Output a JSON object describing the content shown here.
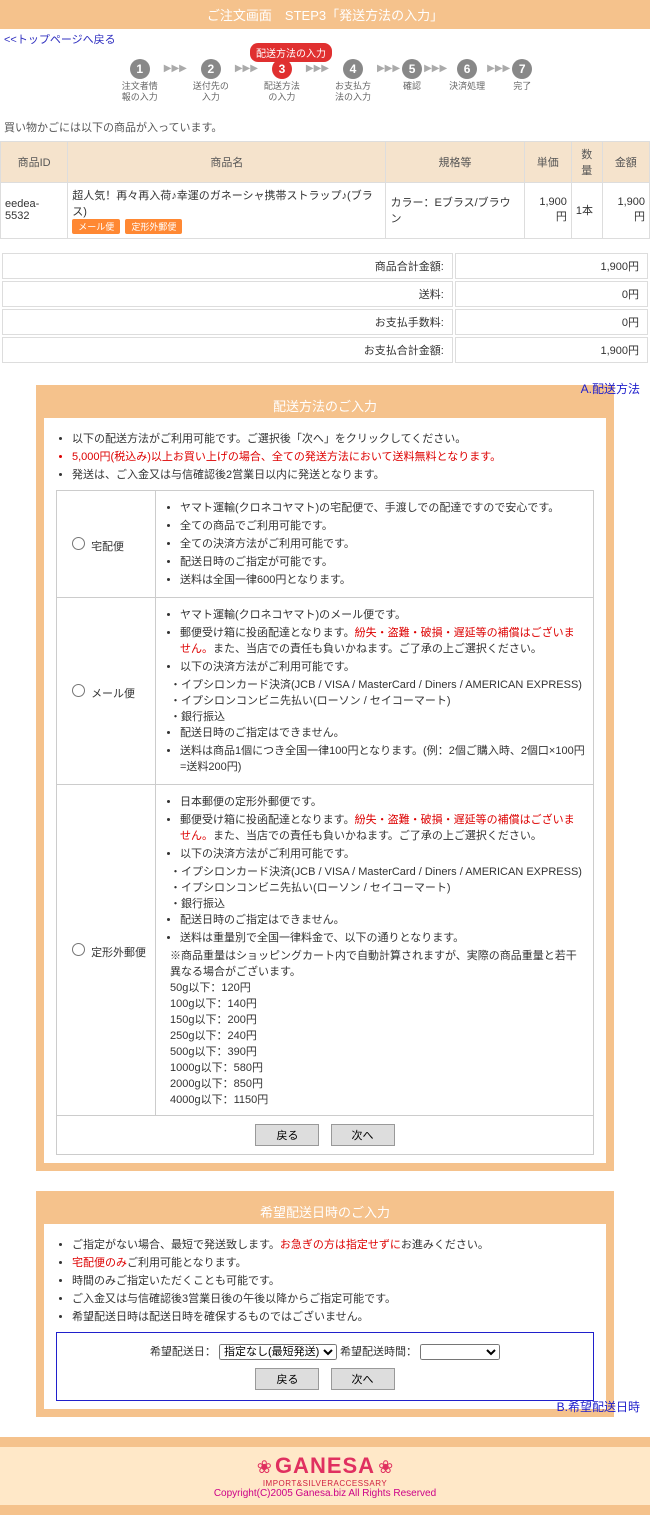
{
  "header": {
    "title": "ご注文画面　STEP3「発送方法の入力」"
  },
  "top_link": "<<トップページへ戻る",
  "balloon": "配送方法の入力",
  "steps": [
    {
      "num": "1",
      "label": "注文者情報の入力"
    },
    {
      "num": "2",
      "label": "送付先の入力"
    },
    {
      "num": "3",
      "label": "配送方法の入力"
    },
    {
      "num": "4",
      "label": "お支払方法の入力"
    },
    {
      "num": "5",
      "label": "確認"
    },
    {
      "num": "6",
      "label": "決済処理"
    },
    {
      "num": "7",
      "label": "完了"
    }
  ],
  "cart_note": "買い物かごには以下の商品が入っています。",
  "cart_headers": {
    "id": "商品ID",
    "name": "商品名",
    "spec": "規格等",
    "price": "単価",
    "qty": "数量",
    "amount": "金額"
  },
  "cart_row": {
    "id": "eedea-5532",
    "name": "超人気！再々再入荷♪幸運のガネーシャ携帯ストラップ♪(ブラス)",
    "badge1": "メール便",
    "badge2": "定形外郵便",
    "spec": "カラー：Eブラス/ブラウン",
    "price": "1,900円",
    "qty": "1本",
    "amount": "1,900円"
  },
  "totals": {
    "l1": "商品合計金額:",
    "v1": "1,900円",
    "l2": "送料:",
    "v2": "0円",
    "l3": "お支払手数料:",
    "v3": "0円",
    "l4": "お支払合計金額:",
    "v4": "1,900円"
  },
  "ship": {
    "head": "配送方法のご入力",
    "intro1": "以下の配送方法がご利用可能です。ご選択後「次へ」をクリックしてください。",
    "intro2": "5,000円(税込み)以上お買い上げの場合、全ての発送方法において送料無料となります。",
    "intro3": "発送は、ご入金又は与信確認後2営業日以内に発送となります。",
    "opt1": {
      "label": "宅配便",
      "l1": "ヤマト運輸(クロネコヤマト)の宅配便で、手渡しでの配達ですので安心です。",
      "l2": "全ての商品でご利用可能です。",
      "l3": "全ての決済方法がご利用可能です。",
      "l4": "配送日時のご指定が可能です。",
      "l5": "送料は全国一律600円となります。"
    },
    "opt2": {
      "label": "メール便",
      "l1": "ヤマト運輸(クロネコヤマト)のメール便です。",
      "l2a": "郵便受け箱に投函配達となります。",
      "l2b": "紛失・盗難・破損・遅延等の補償はございません。",
      "l2c": "また、当店での責任も負いかねます。ご了承の上ご選択ください。",
      "l3": "以下の決済方法がご利用可能です。",
      "l3a": "・イプシロンカード決済(JCB / VISA / MasterCard / Diners / AMERICAN EXPRESS)",
      "l3b": "・イプシロンコンビニ先払い(ローソン / セイコーマート)",
      "l3c": "・銀行振込",
      "l4": "配送日時のご指定はできません。",
      "l5": "送料は商品1個につき全国一律100円となります。(例：2個ご購入時、2個口×100円=送料200円)"
    },
    "opt3": {
      "label": "定形外郵便",
      "l1": "日本郵便の定形外郵便です。",
      "l2a": "郵便受け箱に投函配達となります。",
      "l2b": "紛失・盗難・破損・遅延等の補償はございません。",
      "l2c": "また、当店での責任も負いかねます。ご了承の上ご選択ください。",
      "l3": "以下の決済方法がご利用可能です。",
      "l3a": "・イプシロンカード決済(JCB / VISA / MasterCard / Diners / AMERICAN EXPRESS)",
      "l3b": "・イプシロンコンビニ先払い(ローソン / セイコーマート)",
      "l3c": "・銀行振込",
      "l4": "配送日時のご指定はできません。",
      "l5": "送料は重量別で全国一律料金で、以下の通りとなります。",
      "l5n": "※商品重量はショッピングカート内で自動計算されますが、実際の商品重量と若干異なる場合がございます。",
      "w1": "50g以下：120円",
      "w2": "100g以下：140円",
      "w3": "150g以下：200円",
      "w4": "250g以下：240円",
      "w5": "500g以下：390円",
      "w6": "1000g以下：580円",
      "w7": "2000g以下：850円",
      "w8": "4000g以下：1150円"
    },
    "back": "戻る",
    "next": "次へ"
  },
  "annot_a": "A.配送方法",
  "date": {
    "head": "希望配送日時のご入力",
    "i1a": "ご指定がない場合、最短で発送致します。",
    "i1b": "お急ぎの方は指定せずに",
    "i1c": "お進みください。",
    "i2": "宅配便のみ",
    "i2b": "ご利用可能となります。",
    "i3": "時間のみご指定いただくことも可能です。",
    "i4": "ご入金又は与信確認後3営業日後の午後以降からご指定可能です。",
    "i5": "希望配送日時は配送日時を確保するものではございません。",
    "label1": "希望配送日：",
    "sel1": "指定なし(最短発送)",
    "label2": "希望配送時間：",
    "back": "戻る",
    "next": "次へ"
  },
  "annot_b": "B.希望配送日時",
  "footer": {
    "logo": "GANESA",
    "sub": "IMPORT&SILVERACCESSARY",
    "copy": "Copyright(C)2005 Ganesa.biz All Rights Reserved"
  }
}
